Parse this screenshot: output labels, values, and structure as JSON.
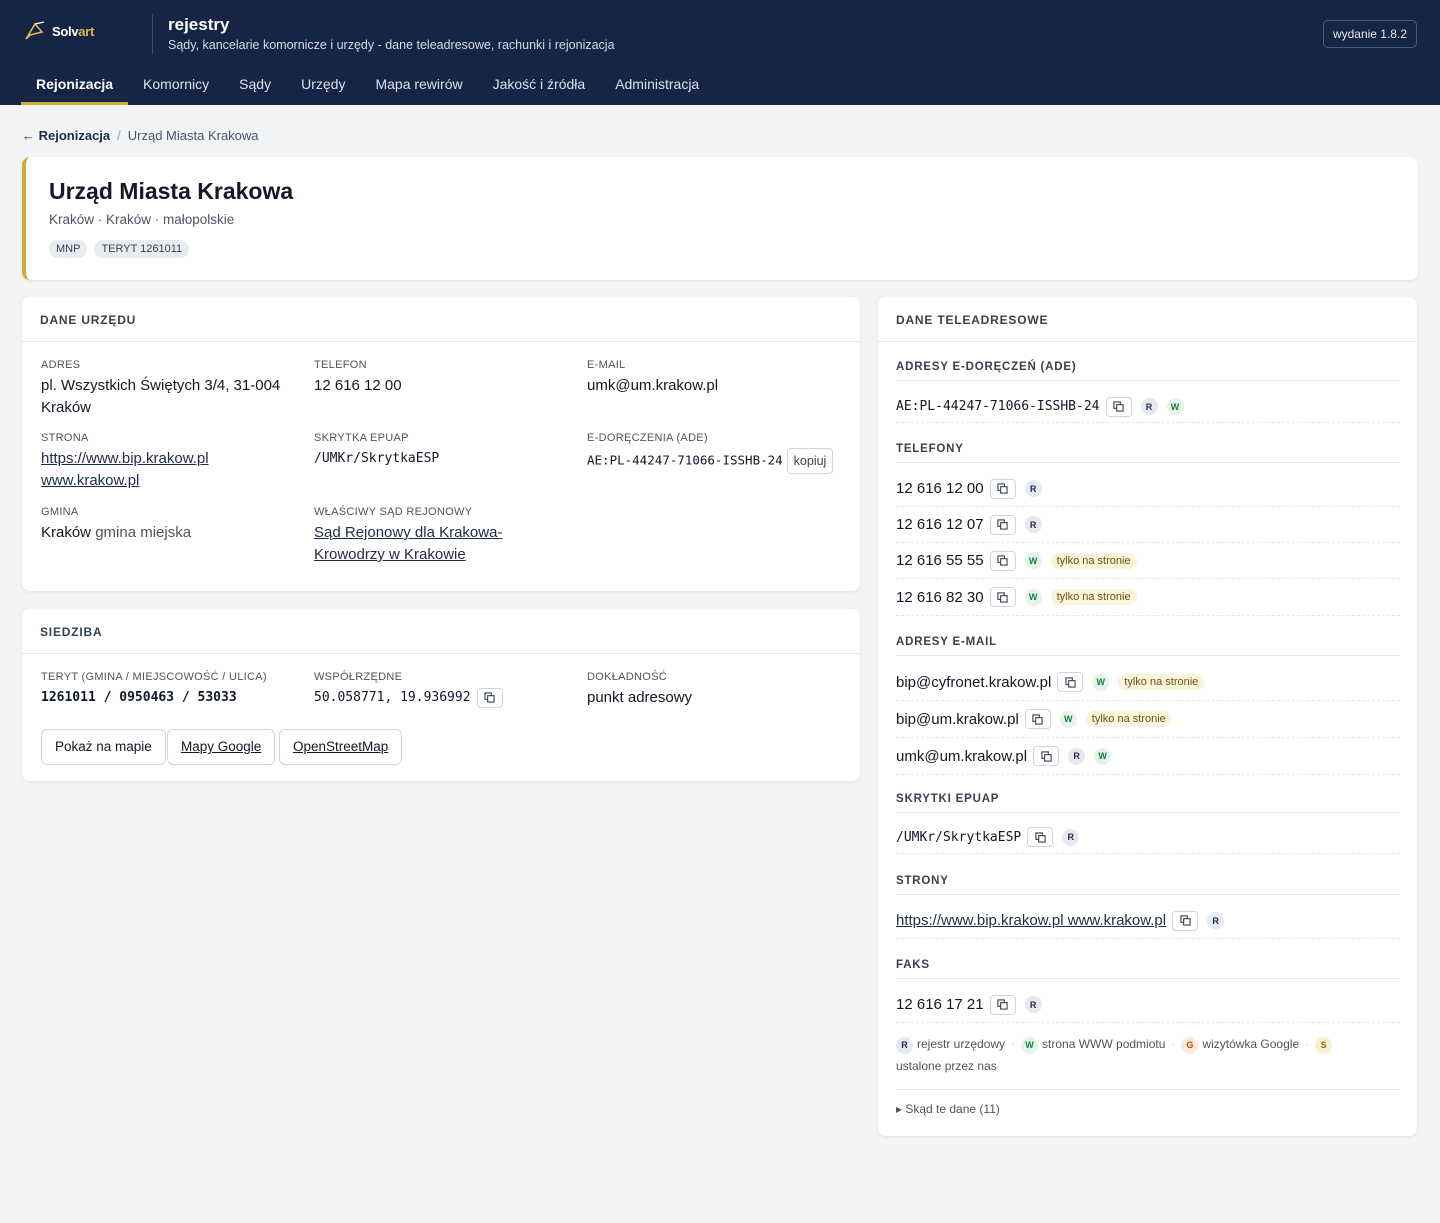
{
  "header": {
    "logo_main": "Solv",
    "logo_accent": "art",
    "app_title": "rejestry",
    "app_subtitle": "Sądy, kancelarie komornicze i urzędy - dane teleadresowe, rachunki i rejonizacja",
    "version": "wydanie 1.8.2",
    "nav": [
      "Rejonizacja",
      "Komornicy",
      "Sądy",
      "Urzędy",
      "Mapa rewirów",
      "Jakość i źródła",
      "Administracja"
    ],
    "nav_active": "Rejonizacja"
  },
  "breadcrumb": {
    "back": "← Rejonizacja",
    "separator": "/",
    "current": "Urząd Miasta Krakowa"
  },
  "office": {
    "name": "Urząd Miasta Krakowa",
    "location": "Kraków · Kraków · małopolskie",
    "pills": [
      "MNP",
      "TERYT 1261011"
    ]
  },
  "dane_urzedu": {
    "title": "DANE URZĘDU",
    "adres_label": "ADRES",
    "adres_line1": "pl. Wszystkich Świętych 3/4, 31-004",
    "adres_line2": "Kraków",
    "telefon_label": "TELEFON",
    "telefon": "12 616 12 00",
    "email_label": "E-MAIL",
    "email": "umk@um.krakow.pl",
    "strona_label": "STRONA",
    "strona_1": "https://www.bip.krakow.pl",
    "strona_2": "www.krakow.pl",
    "skrytka_label": "SKRYTKA EPUAP",
    "skrytka": "/UMKr/SkrytkaESP",
    "ade_label": "E-DORĘCZENIA (ADE)",
    "ade": "AE:PL-44247-71066-ISSHB-24",
    "kopiuj": "kopiuj",
    "gmina_label": "GMINA",
    "gmina_name": "Kraków",
    "gmina_type": "gmina miejska",
    "sad_label": "WŁAŚCIWY SĄD REJONOWY",
    "sad_line1": "Sąd Rejonowy dla Krakowa-",
    "sad_line2": "Krowodrzy w Krakowie"
  },
  "siedziba": {
    "title": "SIEDZIBA",
    "teryt_label": "TERYT (GMINA / MIEJSCOWOŚĆ / ULICA)",
    "teryt": "1261011 / 0950463 / 53033",
    "coords_label": "WSPÓŁRZĘDNE",
    "coords": "50.058771, 19.936992",
    "dokladnosc_label": "DOKŁADNOŚĆ",
    "dokladnosc": "punkt adresowy",
    "btn_map": "Pokaż na mapie",
    "btn_google": "Mapy Google",
    "btn_osm": "OpenStreetMap"
  },
  "teleadresowe": {
    "title": "DANE TELEADRESOWE",
    "ade_title": "ADRESY E-DORĘCZEŃ (ADE)",
    "ade": "AE:PL-44247-71066-ISSHB-24",
    "telefony_title": "TELEFONY",
    "telefony": [
      "12 616 12 00",
      "12 616 12 07",
      "12 616 55 55",
      "12 616 82 30"
    ],
    "email_title": "ADRESY E-MAIL",
    "emails": [
      "bip@cyfronet.krakow.pl",
      "bip@um.krakow.pl",
      "umk@um.krakow.pl"
    ],
    "skrytki_title": "SKRYTKI EPUAP",
    "skrytka": "/UMKr/SkrytkaESP",
    "strony_title": "STRONY",
    "strony": "https://www.bip.krakow.pl www.krakow.pl",
    "faks_title": "FAKS",
    "faks": "12 616 17 21",
    "tag_only_site": "tylko na stronie",
    "badge_r": "R",
    "badge_w": "W",
    "badge_g": "G",
    "badge_s": "S",
    "legend_r": "rejestr urzędowy",
    "legend_w": "strona WWW podmiotu",
    "legend_g": "wizytówka Google",
    "legend_s": "ustalone przez nas",
    "details": "▸ Skąd te dane (11)"
  },
  "colors": {
    "navy": "#162446",
    "gold": "#d4a93a",
    "link": "#1e2b4a"
  }
}
